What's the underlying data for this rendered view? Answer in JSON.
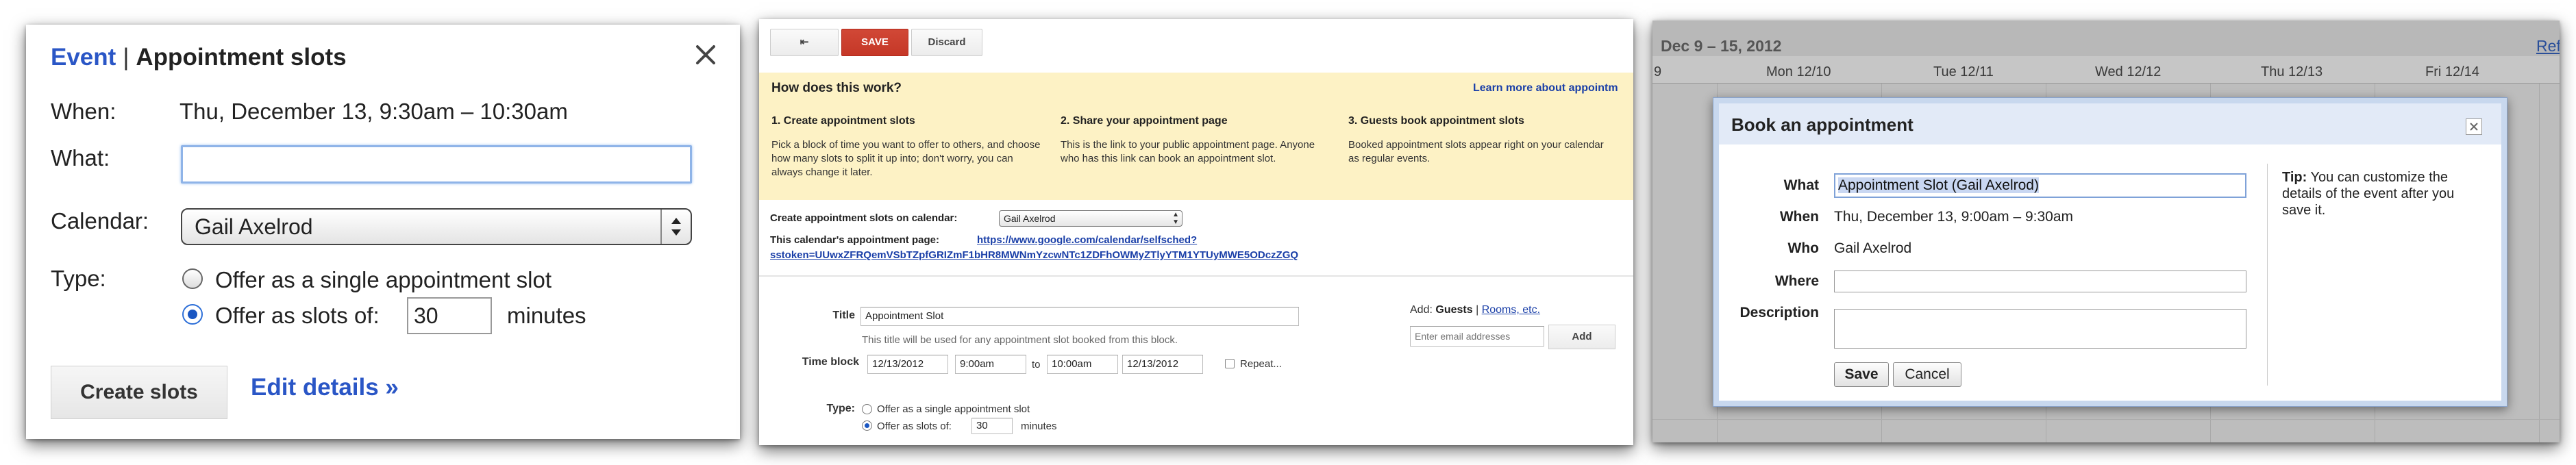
{
  "panel1": {
    "title_link": "Event",
    "title_sep": "|",
    "title_main": "Appointment slots",
    "when_label": "When:",
    "when_value": "Thu, December 13, 9:30am – 10:30am",
    "what_label": "What:",
    "what_value": "",
    "calendar_label": "Calendar:",
    "calendar_value": "Gail Axelrod",
    "type_label": "Type:",
    "option_single": "Offer as a single appointment slot",
    "option_slots": "Offer as slots of:",
    "slot_minutes": "30",
    "minutes_label": "minutes",
    "create_button": "Create slots",
    "edit_details": "Edit details »",
    "selected_option": "slots"
  },
  "panel2": {
    "back_glyph": "⇤",
    "save": "SAVE",
    "discard": "Discard",
    "how_title": "How does this work?",
    "learn_more": "Learn more about appointm",
    "steps": [
      {
        "title": "1. Create appointment slots",
        "text": "Pick a block of time you want to offer to others, and choose how many slots to split it up into; don't worry, you can always change it later."
      },
      {
        "title": "2. Share your appointment page",
        "text": "This is the link to your public appointment page. Anyone who has this link can book an appointment slot."
      },
      {
        "title": "3. Guests book appointment slots",
        "text": "Booked appointment slots appear right on your calendar as regular events."
      }
    ],
    "create_on_label": "Create appointment slots on calendar:",
    "calendar_value": "Gail Axelrod",
    "page_label": "This calendar's appointment page:",
    "page_url_line1": "https://www.google.com/calendar/selfsched?",
    "page_url_line2": "sstoken=UUwxZFRQemVSbTZpfGRIZmF1bHR8MWNmYzcwNTc1ZDFhOWMyZTlyYTM1YTUyMWE5ODczZGQ",
    "title_label": "Title",
    "title_value": "Appointment Slot",
    "title_hint": "This title will be used for any appointment slot booked from this block.",
    "time_block_label": "Time block",
    "start_date": "12/13/2012",
    "start_time": "9:00am",
    "to_label": "to",
    "end_time": "10:00am",
    "end_date": "12/13/2012",
    "repeat_label": "Repeat...",
    "type_label": "Type:",
    "option_single": "Offer as a single appointment slot",
    "option_slots": "Offer as slots of:",
    "slot_minutes": "30",
    "minutes_label": "minutes",
    "add_label": "Add:",
    "guests_label": "Guests",
    "add_sep": "|",
    "rooms_label": "Rooms, etc.",
    "email_placeholder": "Enter email addresses",
    "add_button": "Add"
  },
  "panel3": {
    "date_range": "Dec 9 – 15, 2012",
    "ref_link": "Ref",
    "day_partial": "9",
    "days": [
      "Mon 12/10",
      "Tue 12/11",
      "Wed 12/12",
      "Thu 12/13",
      "Fri 12/14"
    ],
    "dialog_title": "Book an appointment",
    "what_label": "What",
    "what_value": "Appointment Slot (Gail Axelrod)",
    "when_label": "When",
    "when_value": "Thu, December 13, 9:00am – 9:30am",
    "who_label": "Who",
    "who_value": "Gail Axelrod",
    "where_label": "Where",
    "description_label": "Description",
    "save_button": "Save",
    "cancel_button": "Cancel",
    "tip_label": "Tip:",
    "tip_text": " You can customize the details of the event after you save it."
  },
  "colors": {
    "link_blue": "#2a56c6",
    "save_red": "#d14836",
    "info_yellow": "#fdf2c5",
    "dialog_frame": "#c8d8ee"
  },
  "icons": {
    "close": "close-icon",
    "select_arrows": "updown-arrows-icon",
    "back": "back-arrow-icon"
  }
}
